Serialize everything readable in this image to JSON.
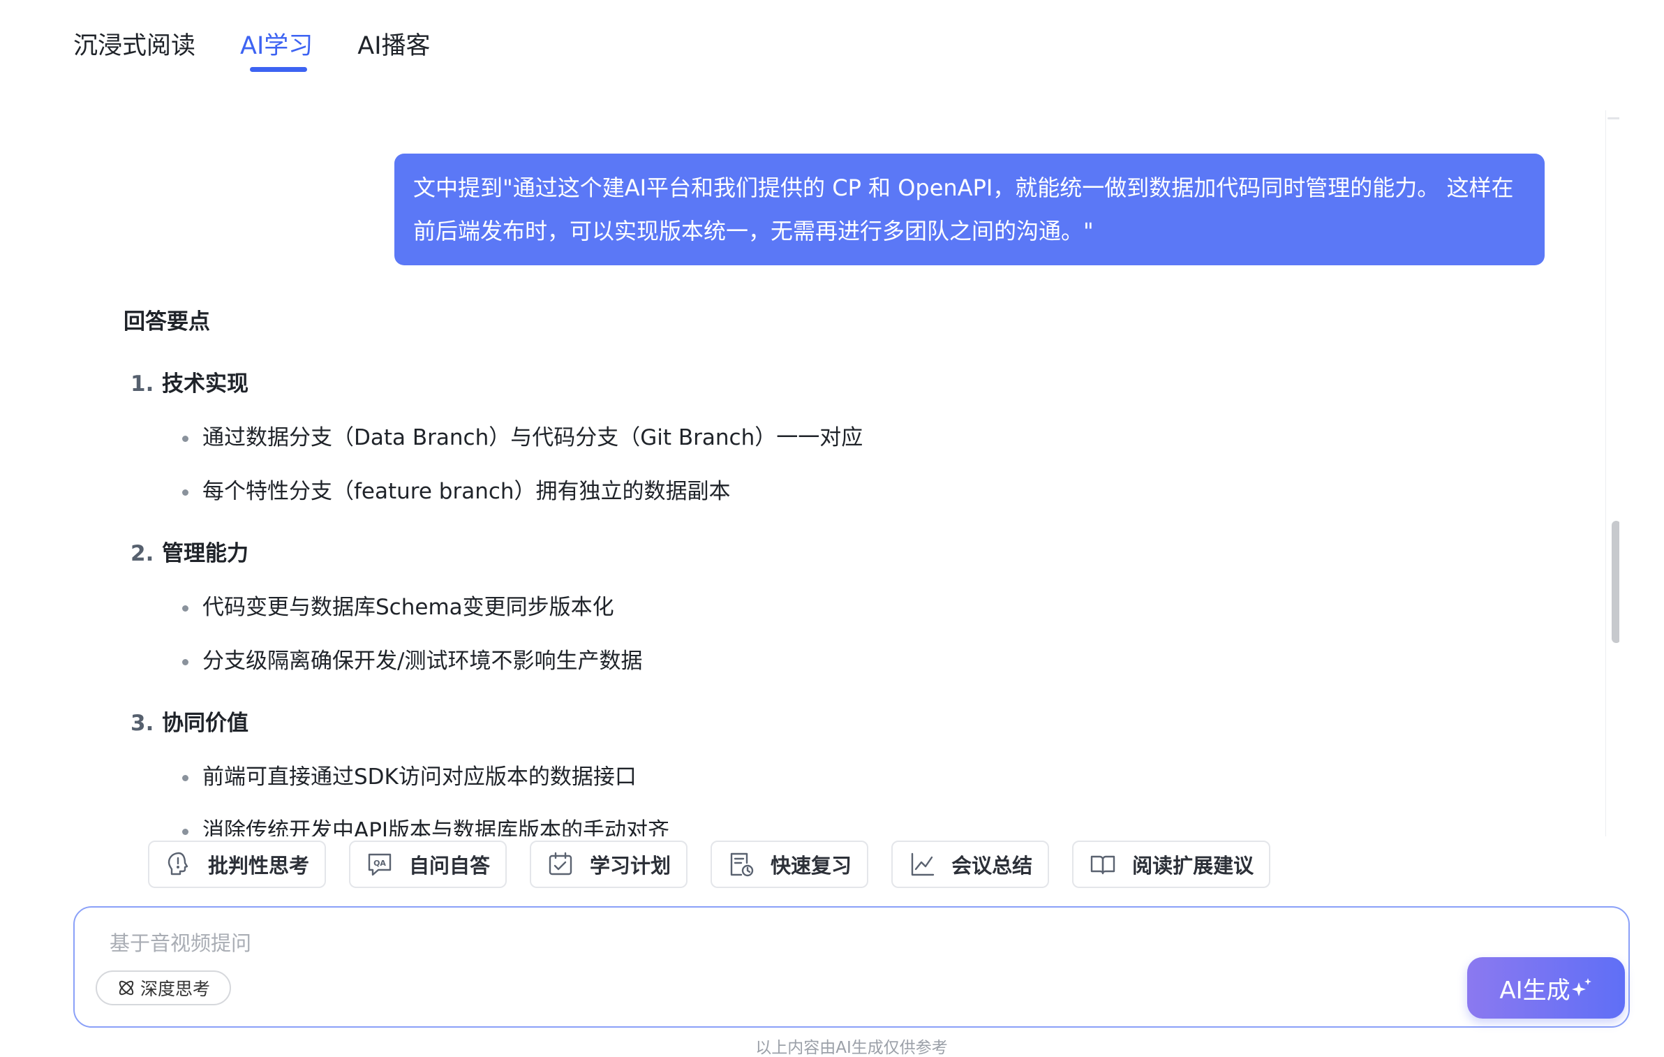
{
  "tabs": [
    {
      "label": "沉浸式阅读",
      "active": false
    },
    {
      "label": "AI学习",
      "active": true
    },
    {
      "label": "AI播客",
      "active": false
    }
  ],
  "colors": {
    "accent": "#3d63f2",
    "bubble": "#5b78f6",
    "generate_from": "#8b79f0",
    "generate_to": "#5f6ff6"
  },
  "user_message": "文中提到\"通过这个建AI平台和我们提供的 CP 和 OpenAPI，就能统一做到数据加代码同时管理的能力。 这样在前后端发布时，可以实现版本统一，无需再进行多团队之间的沟通。\"",
  "answer": {
    "heading": "回答要点",
    "sections": [
      {
        "num": "1.",
        "title": "技术实现",
        "bullets": [
          "通过数据分支（Data Branch）与代码分支（Git Branch）一一对应",
          "每个特性分支（feature branch）拥有独立的数据副本"
        ]
      },
      {
        "num": "2.",
        "title": "管理能力",
        "bullets": [
          "代码变更与数据库Schema变更同步版本化",
          "分支级隔离确保开发/测试环境不影响生产数据"
        ]
      },
      {
        "num": "3.",
        "title": "协同价值",
        "bullets": [
          "前端可直接通过SDK访问对应版本的数据接口",
          "消除传统开发中API版本与数据库版本的手动对齐"
        ]
      }
    ]
  },
  "quick_actions": [
    {
      "label": "批判性思考",
      "icon": "lightbulb-head-icon"
    },
    {
      "label": "自问自答",
      "icon": "qa-bubble-icon"
    },
    {
      "label": "学习计划",
      "icon": "calendar-check-icon"
    },
    {
      "label": "快速复习",
      "icon": "document-clock-icon"
    },
    {
      "label": "会议总结",
      "icon": "line-chart-icon"
    },
    {
      "label": "阅读扩展建议",
      "icon": "open-book-icon"
    }
  ],
  "input": {
    "placeholder": "基于音视频提问",
    "value": ""
  },
  "deep_think_label": "深度思考",
  "generate_label": "AI生成",
  "disclaimer": "以上内容由AI生成仅供参考"
}
